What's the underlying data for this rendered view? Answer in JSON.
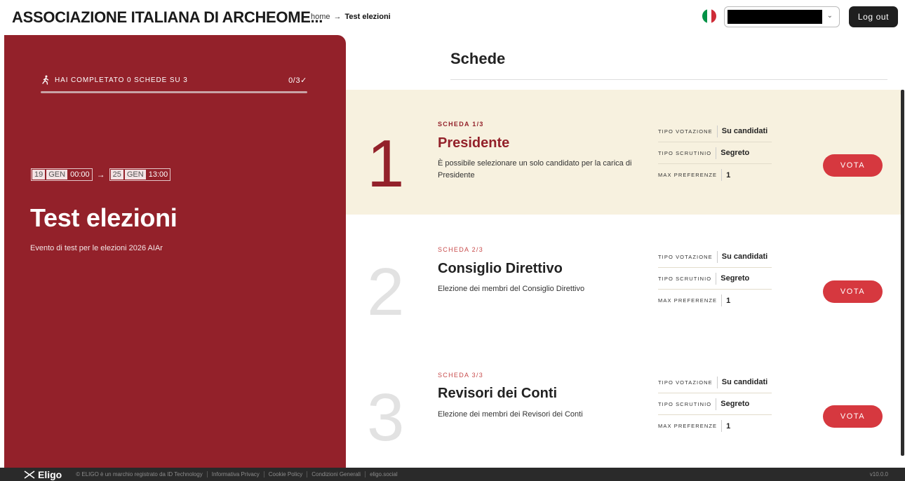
{
  "header": {
    "org_title": "ASSOCIAZIONE ITALIANA DI ARCHEOME...",
    "breadcrumb": {
      "home": "home",
      "separator": "→",
      "current": "Test elezioni"
    },
    "flag_colors": [
      "#009246",
      "#ffffff",
      "#ce2b37"
    ],
    "user_select_chevron": "⌄",
    "logout_label": "Log out"
  },
  "event": {
    "progress_text": "HAI COMPLETATO 0 SCHEDE SU 3",
    "progress_count": "0/3",
    "progress_check": "✓",
    "progress_fraction": 0,
    "start": {
      "day": "19",
      "month": "GEN",
      "time": "00:00"
    },
    "arrow": "→",
    "end": {
      "day": "25",
      "month": "GEN",
      "time": "13:00"
    },
    "title": "Test elezioni",
    "description": "Evento di test per le elezioni 2026 AIAr"
  },
  "schede": {
    "title": "Schede",
    "cards": [
      {
        "number": "1",
        "label": "SCHEDA 1/3",
        "name": "Presidente",
        "description": "È possibile selezionare un solo candidato per la carica di Presidente",
        "meta": [
          {
            "label": "TIPO VOTAZIONE",
            "value": "Su candidati"
          },
          {
            "label": "TIPO SCRUTINIO",
            "value": "Segreto"
          },
          {
            "label": "MAX PREFERENZE",
            "value": "1"
          }
        ],
        "button": "VOTA"
      },
      {
        "number": "2",
        "label": "SCHEDA 2/3",
        "name": "Consiglio Direttivo",
        "description": "Elezione dei membri del Consiglio Direttivo",
        "meta": [
          {
            "label": "TIPO VOTAZIONE",
            "value": "Su candidati"
          },
          {
            "label": "TIPO SCRUTINIO",
            "value": "Segreto"
          },
          {
            "label": "MAX PREFERENZE",
            "value": "1"
          }
        ],
        "button": "VOTA"
      },
      {
        "number": "3",
        "label": "SCHEDA 3/3",
        "name": "Revisori dei Conti",
        "description": "Elezione dei membri dei Revisori dei Conti",
        "meta": [
          {
            "label": "TIPO VOTAZIONE",
            "value": "Su candidati"
          },
          {
            "label": "TIPO SCRUTINIO",
            "value": "Segreto"
          },
          {
            "label": "MAX PREFERENZE",
            "value": "1"
          }
        ],
        "button": "VOTA"
      }
    ]
  },
  "footer": {
    "logo_text": "Eligo",
    "links": [
      "© ELIGO è un marchio registrato da ID Technology",
      "Informativa Privacy",
      "Cookie Policy",
      "Condizioni Generali",
      "eligo.social"
    ],
    "version": "v10.0.0"
  },
  "colors": {
    "panel": "#93212a",
    "active_card": "#f7f1df",
    "vote_button": "#d6383f"
  }
}
